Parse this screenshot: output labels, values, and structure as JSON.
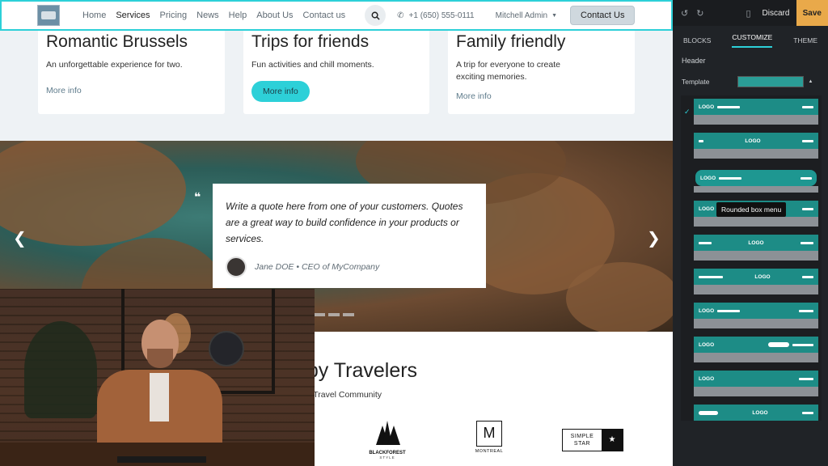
{
  "header": {
    "nav": [
      "Home",
      "Services",
      "Pricing",
      "News",
      "Help",
      "About Us",
      "Contact us"
    ],
    "active_nav": "Services",
    "phone": "+1 (650) 555-0111",
    "user": "Mitchell Admin",
    "contact_label": "Contact Us",
    "logo_alt": "WORLD TRAVEL"
  },
  "cards": [
    {
      "title": "Romantic Brussels",
      "text": "An unforgettable experience for two.",
      "cta": "More info"
    },
    {
      "title": "Trips for friends",
      "text": "Fun activities and chill moments.",
      "cta": "More info"
    },
    {
      "title": "Family friendly",
      "text": "A trip for everyone to create exciting memories.",
      "cta": "More info"
    }
  ],
  "hero": {
    "quote": "Write a quote here from one of your customers. Quotes are a great way to build confidence in your products or services.",
    "author": "Jane DOE • CEO of MyCompany"
  },
  "lower": {
    "title": "ppy Travelers",
    "subtitle": "r Travel Community",
    "brands": [
      "BLACKFOREST",
      "MONTREAL",
      "SIMPLE STAR"
    ],
    "brand_sub": "STYLE"
  },
  "panel": {
    "discard": "Discard",
    "save": "Save",
    "tabs": [
      "BLOCKS",
      "CUSTOMIZE",
      "THEME"
    ],
    "active_tab": "CUSTOMIZE",
    "section": "Header",
    "template_label": "Template",
    "tooltip": "Rounded box menu",
    "logo_word": "LOGO"
  },
  "colors": {
    "accent": "#2dd0d8",
    "save": "#e9a94a",
    "header_teal": "#1d8c86"
  }
}
